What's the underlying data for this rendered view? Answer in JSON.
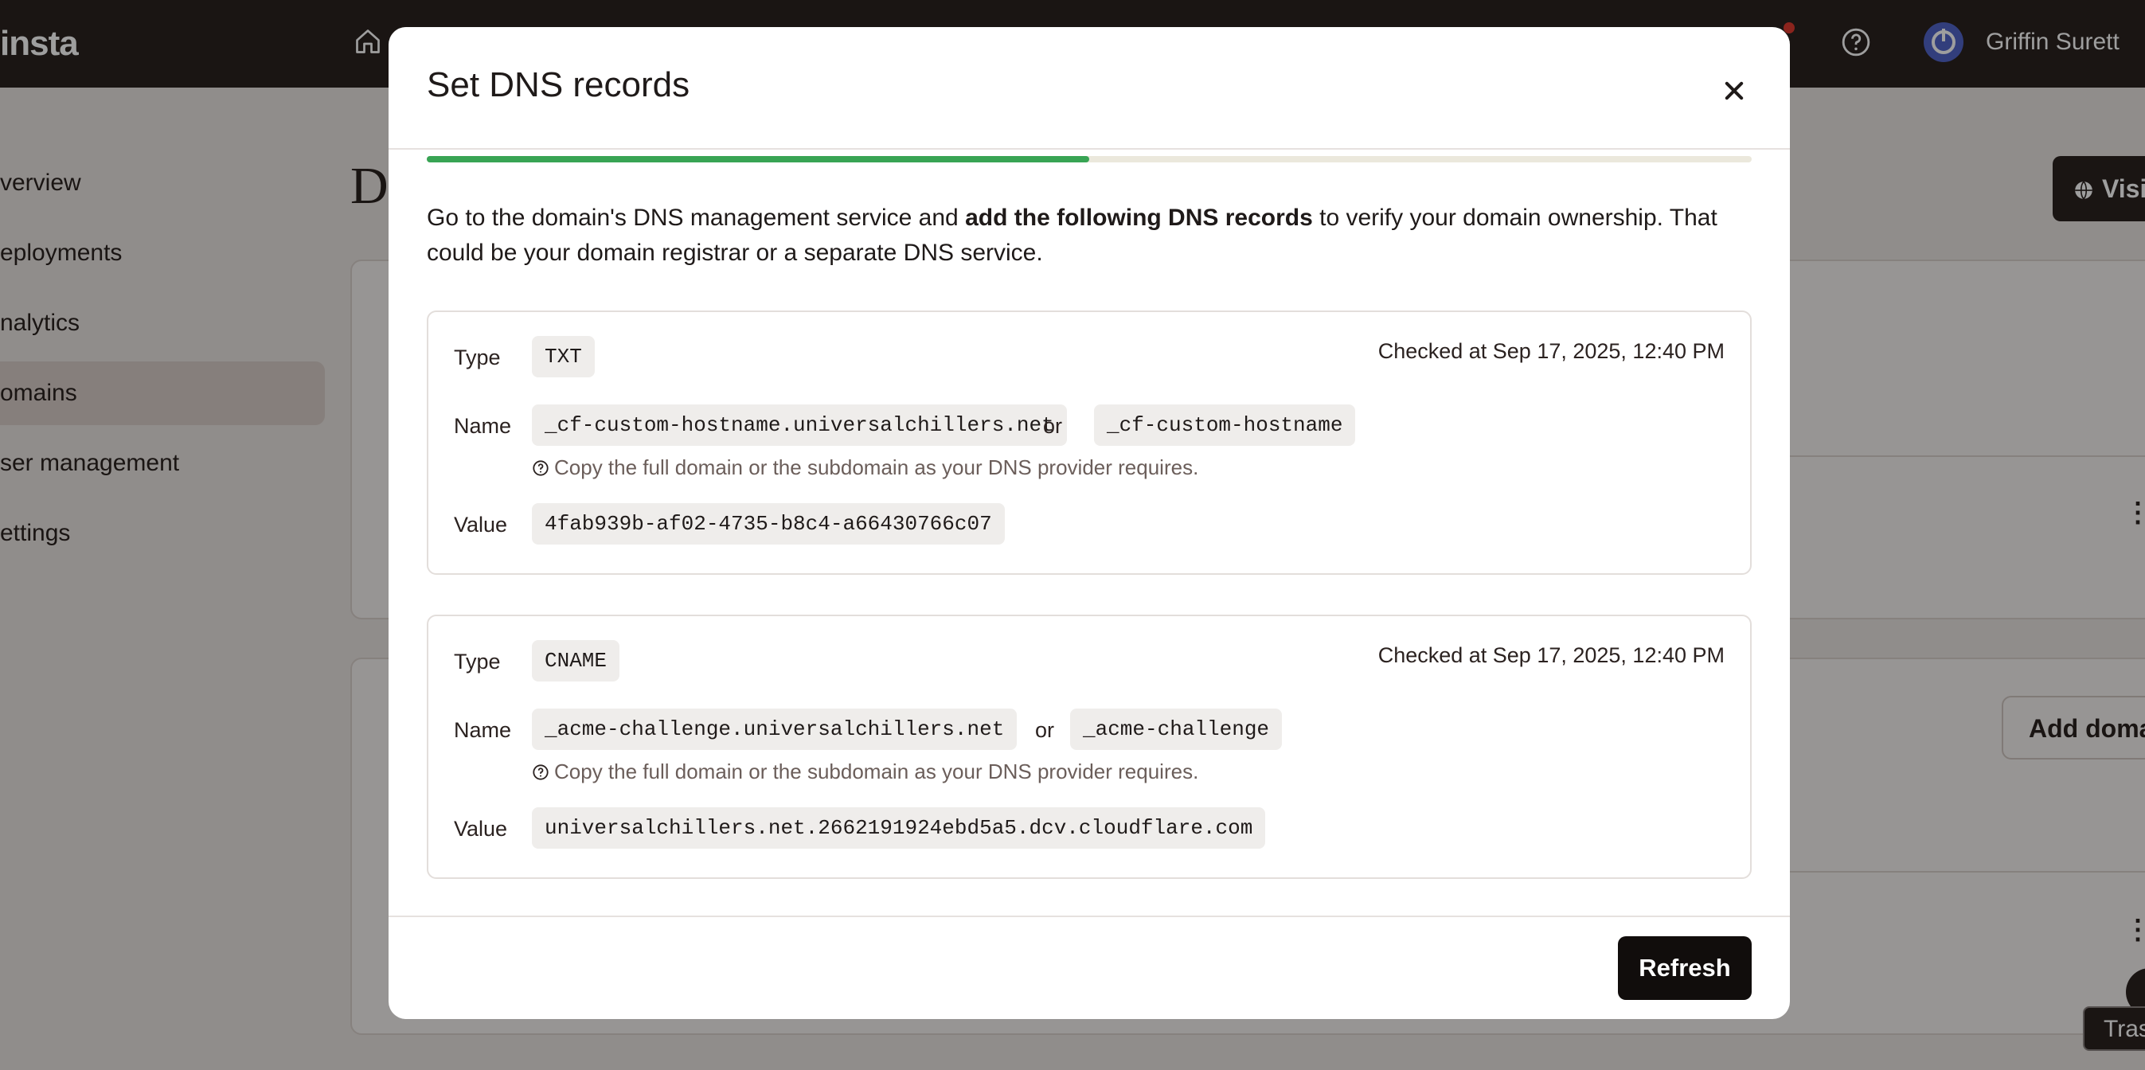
{
  "app": {
    "logo": "insta",
    "user_name": "Griffin Surett",
    "sidebar": [
      {
        "label": "verview"
      },
      {
        "label": "eployments"
      },
      {
        "label": "nalytics"
      },
      {
        "label": "omains",
        "active": true
      },
      {
        "label": "ser management"
      },
      {
        "label": "ettings"
      }
    ],
    "page_title": "D",
    "visit_button": "Visi",
    "add_domain_button": "Add domai",
    "trash_tooltip": "Tras"
  },
  "modal": {
    "title": "Set DNS records",
    "progress": 0.5,
    "intro_pre": "Go to the domain's DNS management service and ",
    "intro_bold": "add the following DNS records",
    "intro_post": " to verify your domain ownership. That could be your domain registrar or a separate DNS service.",
    "labels": {
      "type": "Type",
      "name": "Name",
      "value": "Value",
      "or": "or"
    },
    "records": [
      {
        "type": "TXT",
        "checked": "Checked at Sep 17, 2025, 12:40 PM",
        "name_full": "_cf-custom-hostname.universalchillers.net",
        "name_short": "_cf-custom-hostname",
        "hint": "Copy the full domain or the subdomain as your DNS provider requires.",
        "value": "4fab939b-af02-4735-b8c4-a66430766c07"
      },
      {
        "type": "CNAME",
        "checked": "Checked at Sep 17, 2025, 12:40 PM",
        "name_full": "_acme-challenge.universalchillers.net",
        "name_short": "_acme-challenge",
        "hint": "Copy the full domain or the subdomain as your DNS provider requires.",
        "value": "universalchillers.net.2662191924ebd5a5.dcv.cloudflare.com"
      }
    ],
    "refresh_button": "Refresh"
  },
  "colors": {
    "progress": "#38a454",
    "topbar": "#2b2220",
    "button": "#110d0c"
  },
  "icons": [
    "home-icon",
    "help-icon",
    "close-icon",
    "question-circle-icon",
    "globe-icon",
    "kebab-menu-icon"
  ]
}
